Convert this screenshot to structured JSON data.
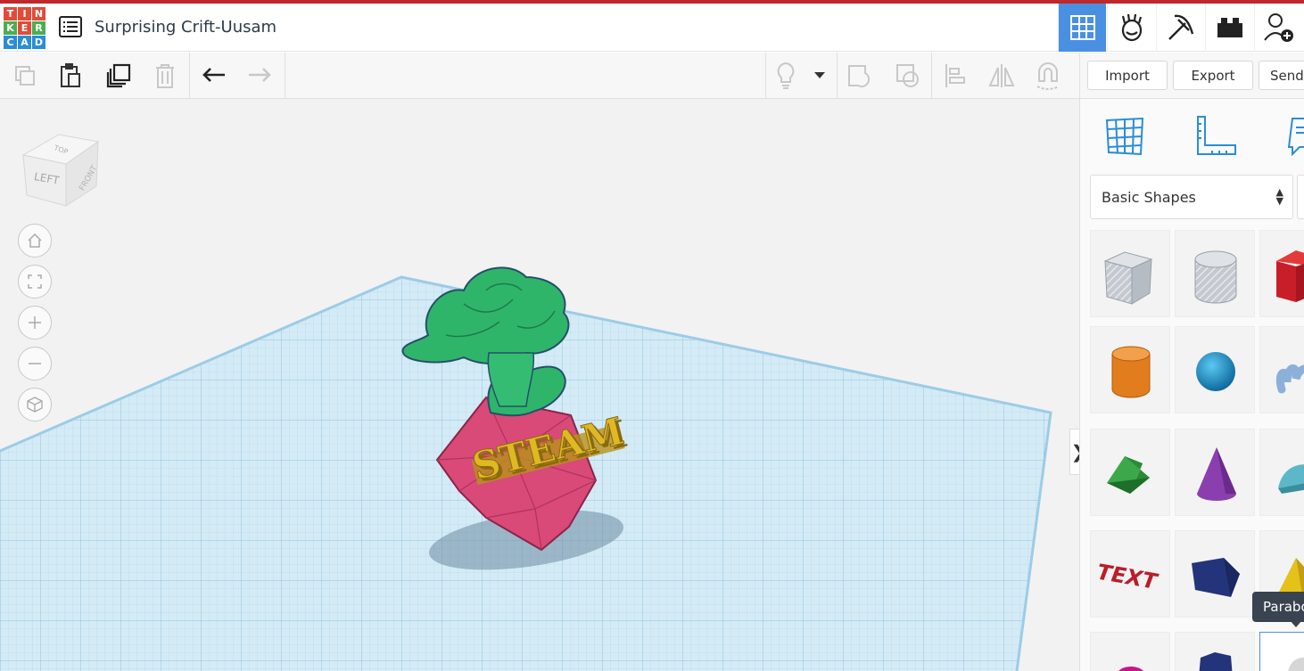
{
  "app": {
    "logo_letters": [
      "T",
      "I",
      "N",
      "K",
      "E",
      "R",
      "C",
      "A",
      "D"
    ],
    "logo_colors": [
      "#e24b38",
      "#e24b38",
      "#e24b38",
      "#4cae4f",
      "#e24b38",
      "#4cae4f",
      "#2b8dd6",
      "#2b8dd6",
      "#2b8dd6"
    ],
    "project_title": "Surprising Crift-Uusam"
  },
  "header_buttons": [
    {
      "name": "3d-design-view",
      "icon": "grid-icon",
      "active": true
    },
    {
      "name": "blocks-view",
      "icon": "blocks-icon",
      "active": false
    },
    {
      "name": "minecraft-view",
      "icon": "pickaxe-icon",
      "active": false
    },
    {
      "name": "lego-view",
      "icon": "brick-icon",
      "active": false
    },
    {
      "name": "user-share",
      "icon": "add-user-icon",
      "active": false
    }
  ],
  "toolbar": {
    "import_label": "Import",
    "export_label": "Export",
    "send_label": "Send"
  },
  "viewcube": {
    "top": "TOP",
    "left": "LEFT",
    "front": "FRONT"
  },
  "scene": {
    "model_text": "STEAM",
    "base_color": "#d94a78",
    "plant_color": "#2fb56a",
    "text_color": "#e0b822"
  },
  "panel": {
    "category": "Basic Shapes",
    "tooltip": "Parabo",
    "shapes": [
      {
        "name": "box-hole",
        "icon": "box-icon"
      },
      {
        "name": "cylinder-hole",
        "icon": "cylinder-icon"
      },
      {
        "name": "box",
        "icon": "red-box-icon"
      },
      {
        "name": "cylinder",
        "icon": "orange-cylinder-icon"
      },
      {
        "name": "sphere",
        "icon": "sphere-icon"
      },
      {
        "name": "scribble",
        "icon": "scribble-icon"
      },
      {
        "name": "roof",
        "icon": "roof-icon"
      },
      {
        "name": "cone",
        "icon": "cone-icon"
      },
      {
        "name": "round-roof",
        "icon": "round-roof-icon"
      },
      {
        "name": "text",
        "icon": "text-icon",
        "label": "TEXT"
      },
      {
        "name": "polygon",
        "icon": "polygon-icon"
      },
      {
        "name": "pyramid",
        "icon": "pyramid-icon"
      }
    ]
  }
}
